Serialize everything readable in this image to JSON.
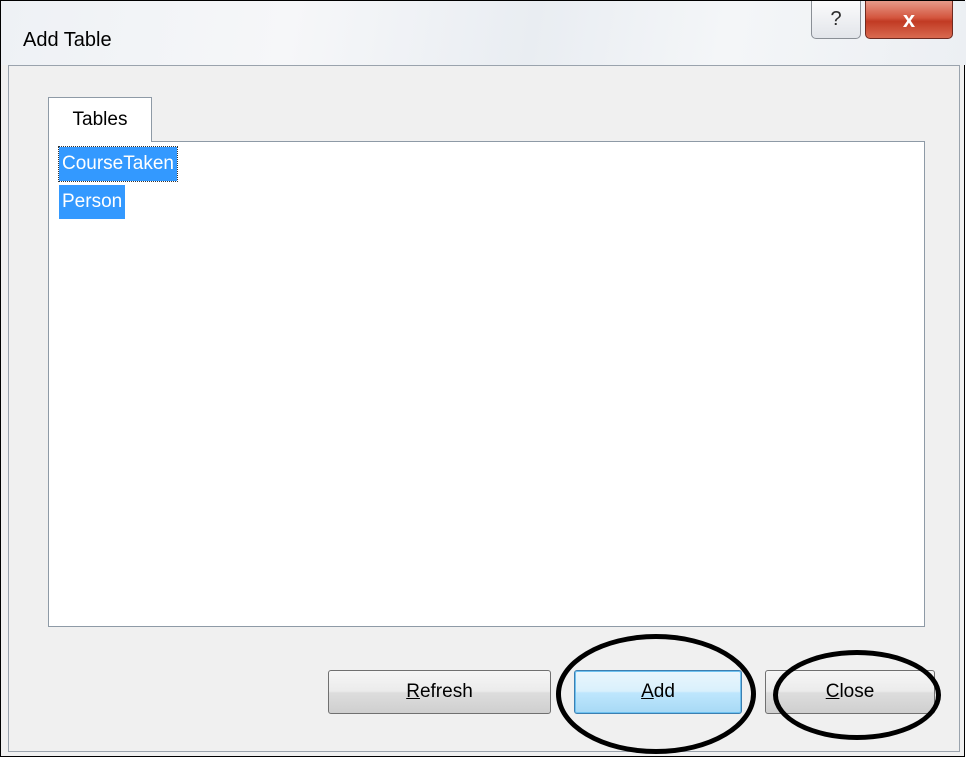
{
  "window": {
    "title": "Add Table",
    "help_label": "?",
    "close_label": "x"
  },
  "tabs": [
    {
      "label": "Tables",
      "selected": true
    }
  ],
  "list": {
    "items": [
      {
        "label": "CourseTaken",
        "selected": true
      },
      {
        "label": "Person",
        "selected": true
      }
    ]
  },
  "buttons": {
    "refresh": {
      "accel": "R",
      "rest": "efresh"
    },
    "add": {
      "accel": "A",
      "rest": "dd"
    },
    "close": {
      "accel": "C",
      "rest": "lose"
    }
  },
  "colors": {
    "selection": "#3399ff",
    "close_button": "#c13a23",
    "annotation": "#000000"
  }
}
